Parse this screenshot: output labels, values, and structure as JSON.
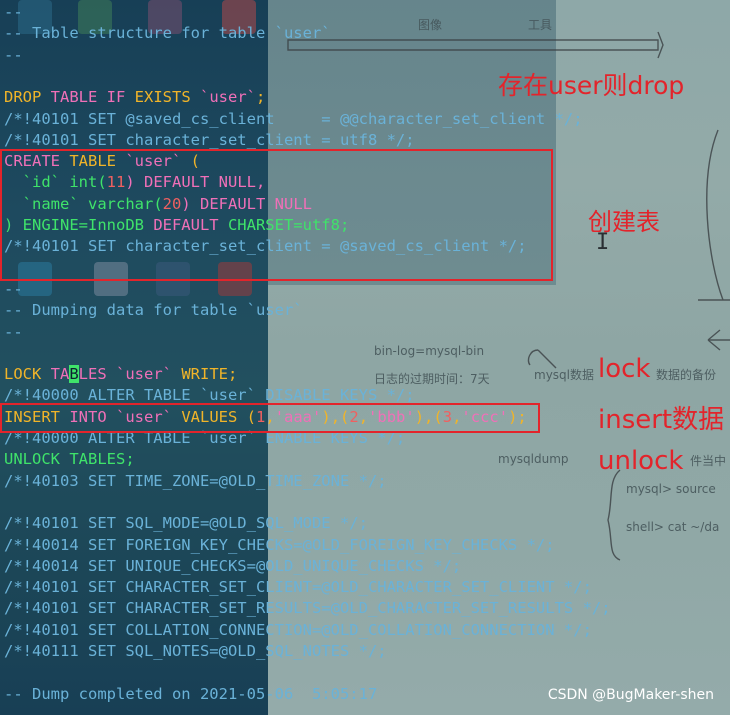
{
  "code_lines": [
    [
      [
        "--",
        "k-cm"
      ]
    ],
    [
      [
        "-- Table structure for table `user`",
        "k-cm"
      ]
    ],
    [
      [
        "--",
        "k-cm"
      ]
    ],
    [],
    [
      [
        "DROP",
        "k-or"
      ],
      [
        " TABLE IF ",
        "k-pk"
      ],
      [
        "EXISTS",
        "k-or"
      ],
      [
        " ",
        "k-wh"
      ],
      [
        "`user`",
        "k-pk"
      ],
      [
        ";",
        "k-or"
      ]
    ],
    [
      [
        "/*!40101 SET @saved_cs_client     = @@character_set_client */;",
        "k-cm"
      ]
    ],
    [
      [
        "/*!40101 SET character_set_client = utf8 */;",
        "k-cm"
      ]
    ],
    [
      [
        "CREATE",
        "k-pk"
      ],
      [
        " TABLE ",
        "k-or"
      ],
      [
        "`user`",
        "k-pk"
      ],
      [
        " (",
        "k-or"
      ]
    ],
    [
      [
        "  ",
        "k-wh"
      ],
      [
        "`id`",
        "k-gn"
      ],
      [
        " int(",
        "k-gn"
      ],
      [
        "11",
        "k-rd"
      ],
      [
        ") DEFAULT NULL,",
        "k-pk"
      ]
    ],
    [
      [
        "  ",
        "k-wh"
      ],
      [
        "`name`",
        "k-gn"
      ],
      [
        " varchar(",
        "k-gn"
      ],
      [
        "20",
        "k-rd"
      ],
      [
        ") DEFAULT NULL",
        "k-pk"
      ]
    ],
    [
      [
        ") ENGINE=InnoDB ",
        "k-gn"
      ],
      [
        "DEFAULT",
        "k-pk"
      ],
      [
        " CHARSET=utf8;",
        "k-gn"
      ]
    ],
    [
      [
        "/*!40101 SET character_set_client = @saved_cs_client */;",
        "k-cm"
      ]
    ],
    [],
    [
      [
        "--",
        "k-cm"
      ]
    ],
    [
      [
        "-- Dumping data for table `user`",
        "k-cm"
      ]
    ],
    [
      [
        "--",
        "k-cm"
      ]
    ],
    [],
    [
      [
        "LOCK",
        "k-or"
      ],
      [
        " TA",
        "k-pk"
      ],
      [
        "B",
        "cursor"
      ],
      [
        "LES ",
        "k-pk"
      ],
      [
        "`user`",
        "k-pk"
      ],
      [
        " WRITE;",
        "k-or"
      ]
    ],
    [
      [
        "/*!40000 ALTER TABLE `user` DISABLE KEYS */;",
        "k-cm"
      ]
    ],
    [
      [
        "INSERT",
        "k-or"
      ],
      [
        " INTO ",
        "k-pk"
      ],
      [
        "`user`",
        "k-pk"
      ],
      [
        " VALUES (",
        "k-or"
      ],
      [
        "1",
        "k-rd"
      ],
      [
        ",",
        "k-or"
      ],
      [
        "'aaa'",
        "k-pk"
      ],
      [
        "),(",
        "k-or"
      ],
      [
        "2",
        "k-rd"
      ],
      [
        ",",
        "k-or"
      ],
      [
        "'bbb'",
        "k-pk"
      ],
      [
        "),(",
        "k-or"
      ],
      [
        "3",
        "k-rd"
      ],
      [
        ",",
        "k-or"
      ],
      [
        "'ccc'",
        "k-pk"
      ],
      [
        ");",
        "k-or"
      ]
    ],
    [
      [
        "/*!40000 ALTER TABLE `user` ENABLE KEYS */;",
        "k-cm"
      ]
    ],
    [
      [
        "UNLOCK TABLES;",
        "k-gn"
      ]
    ],
    [
      [
        "/*!40103 SET TIME_ZONE=@OLD_TIME_ZONE */;",
        "k-cm"
      ]
    ],
    [],
    [
      [
        "/*!40101 SET SQL_MODE=@OLD_SQL_MODE */;",
        "k-cm"
      ]
    ],
    [
      [
        "/*!40014 SET FOREIGN_KEY_CHECKS=@OLD_FOREIGN_KEY_CHECKS */;",
        "k-cm"
      ]
    ],
    [
      [
        "/*!40014 SET UNIQUE_CHECKS=@OLD_UNIQUE_CHECKS */;",
        "k-cm"
      ]
    ],
    [
      [
        "/*!40101 SET CHARACTER_SET_CLIENT=@OLD_CHARACTER_SET_CLIENT */;",
        "k-cm"
      ]
    ],
    [
      [
        "/*!40101 SET CHARACTER_SET_RESULTS=@OLD_CHARACTER_SET_RESULTS */;",
        "k-cm"
      ]
    ],
    [
      [
        "/*!40101 SET COLLATION_CONNECTION=@OLD_COLLATION_CONNECTION */;",
        "k-cm"
      ]
    ],
    [
      [
        "/*!40111 SET SQL_NOTES=@OLD_SQL_NOTES */;",
        "k-cm"
      ]
    ],
    [],
    [
      [
        "-- Dump completed on 2021-05-06  5:05:17",
        "k-cm"
      ]
    ]
  ],
  "annotations": {
    "drop": "存在user则drop",
    "create": "创建表",
    "lock": "lock",
    "insert": "insert数据",
    "unlock": "unlock"
  },
  "background_text": {
    "toolbar_a": "图像",
    "toolbar_b": "工具",
    "bin_log": "bin-log=mysql-bin",
    "expire": "日志的过期时间：7天",
    "mysql_data": "mysql数据",
    "backup": "数据的备份",
    "mysqldump": "mysqldump",
    "file_in": "件当中",
    "mysql_source": "mysql> source",
    "shell_cat": "shell> cat ~/da"
  },
  "watermark": "CSDN @BugMaker-shen",
  "colors": {
    "annotation_red": "#e3242b",
    "keyword_orange": "#f0b429",
    "keyword_pink": "#f070b8",
    "keyword_green": "#3fe36a",
    "comment_blue": "#6ab2d8"
  }
}
